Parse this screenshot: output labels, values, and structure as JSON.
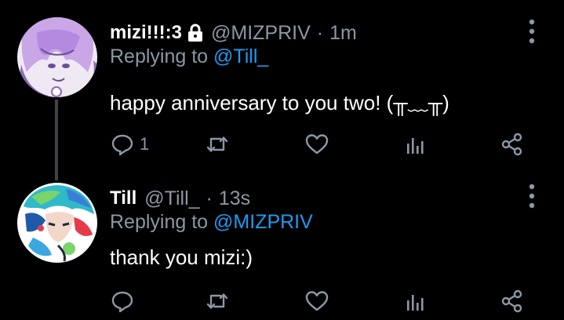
{
  "tweets": [
    {
      "display_name": "mizi!!!:3",
      "handle": "@MIZPRIV",
      "separator": "·",
      "time": "1m",
      "replying_prefix": "Replying to ",
      "replying_handle": "@Till_",
      "text": "happy anniversary to you two! (╥﹏╥)",
      "reply_count": "1",
      "protected": true
    },
    {
      "display_name": "Till",
      "handle": "@Till_",
      "separator": "·",
      "time": "13s",
      "replying_prefix": "Replying to ",
      "replying_handle": "@MIZPRIV",
      "text": "thank you mizi:)",
      "reply_count": "",
      "protected": false
    }
  ],
  "icons": [
    "lock-icon",
    "more-vertical-icon",
    "reply-icon",
    "retweet-icon",
    "like-icon",
    "stats-icon",
    "share-icon"
  ],
  "colors": {
    "background": "#000000",
    "text_primary": "#ffffff",
    "text_secondary": "#8b98a5",
    "link": "#1d9bf0",
    "thread_line": "#3d4349"
  }
}
